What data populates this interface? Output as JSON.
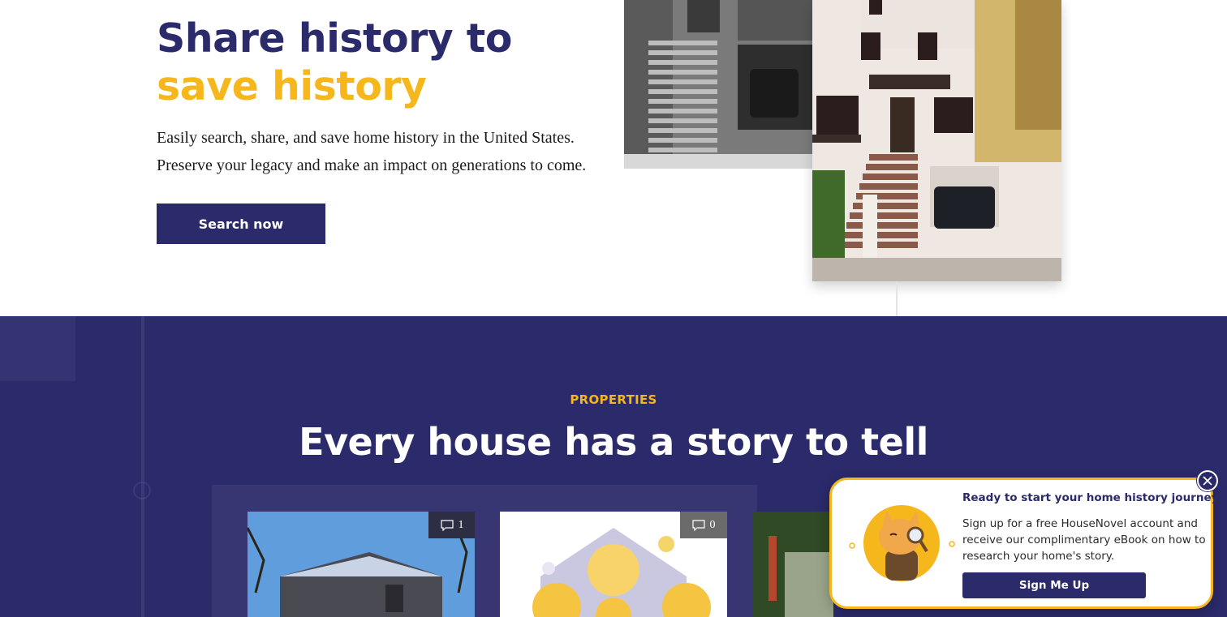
{
  "hero": {
    "title_line1": "Share history to",
    "title_line2": "save history",
    "subtitle_line1": "Easily search, share, and save home history in the United States.",
    "subtitle_line2": "Preserve your legacy and make an impact on generations to come.",
    "cta_label": "Search now"
  },
  "properties": {
    "eyebrow": "PROPERTIES",
    "title": "Every house has a story to tell",
    "cards": [
      {
        "comment_count": "1"
      },
      {
        "comment_count": "0"
      }
    ]
  },
  "popup": {
    "heading": "Ready to start your home history journey?",
    "body": "Sign up for a free HouseNovel account and receive our complimentary eBook on how to research your home's story.",
    "button_label": "Sign Me Up"
  },
  "colors": {
    "brand_navy": "#2b2a6b",
    "brand_yellow": "#f5b71c"
  },
  "icons": [
    "comment-icon",
    "close-icon",
    "magnifier-icon"
  ]
}
